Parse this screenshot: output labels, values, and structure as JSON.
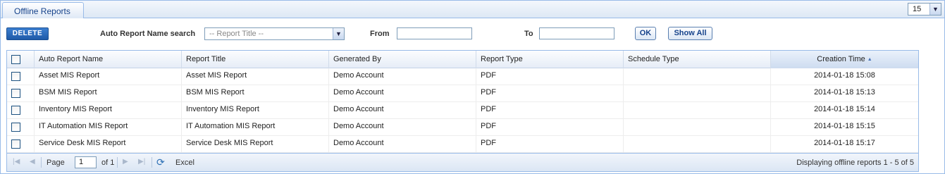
{
  "tab": {
    "title": "Offline Reports"
  },
  "per_page": {
    "value": "15"
  },
  "toolbar": {
    "delete_label": "DELETE",
    "search_label": "Auto Report Name search",
    "report_title_placeholder": "-- Report Title --",
    "from_label": "From",
    "from_value": "",
    "to_label": "To",
    "to_value": "",
    "ok_label": "OK",
    "show_all_label": "Show All"
  },
  "grid": {
    "columns": [
      "Auto Report Name",
      "Report Title",
      "Generated By",
      "Report Type",
      "Schedule Type",
      "Creation Time"
    ],
    "sorted_column": "Creation Time",
    "rows": [
      {
        "auto_name": "Asset MIS Report",
        "title": "Asset MIS Report",
        "generated_by": "Demo Account",
        "type": "PDF",
        "schedule": "",
        "created": "2014-01-18 15:08"
      },
      {
        "auto_name": "BSM MIS Report",
        "title": "BSM MIS Report",
        "generated_by": "Demo Account",
        "type": "PDF",
        "schedule": "",
        "created": "2014-01-18 15:13"
      },
      {
        "auto_name": "Inventory MIS Report",
        "title": "Inventory MIS Report",
        "generated_by": "Demo Account",
        "type": "PDF",
        "schedule": "",
        "created": "2014-01-18 15:14"
      },
      {
        "auto_name": "IT Automation MIS Report",
        "title": "IT Automation MIS Report",
        "generated_by": "Demo Account",
        "type": "PDF",
        "schedule": "",
        "created": "2014-01-18 15:15"
      },
      {
        "auto_name": "Service Desk MIS Report",
        "title": "Service Desk MIS Report",
        "generated_by": "Demo Account",
        "type": "PDF",
        "schedule": "",
        "created": "2014-01-18 15:17"
      }
    ]
  },
  "paging": {
    "page_label": "Page",
    "page_value": "1",
    "of_label": "of 1",
    "excel_label": "Excel",
    "display_text": "Displaying offline reports 1 - 5 of 5"
  },
  "icons": {
    "first": "first-page-icon",
    "prev": "prev-page-icon",
    "next": "next-page-icon",
    "last": "last-page-icon",
    "refresh": "refresh-icon",
    "sort": "sort-asc-icon"
  }
}
